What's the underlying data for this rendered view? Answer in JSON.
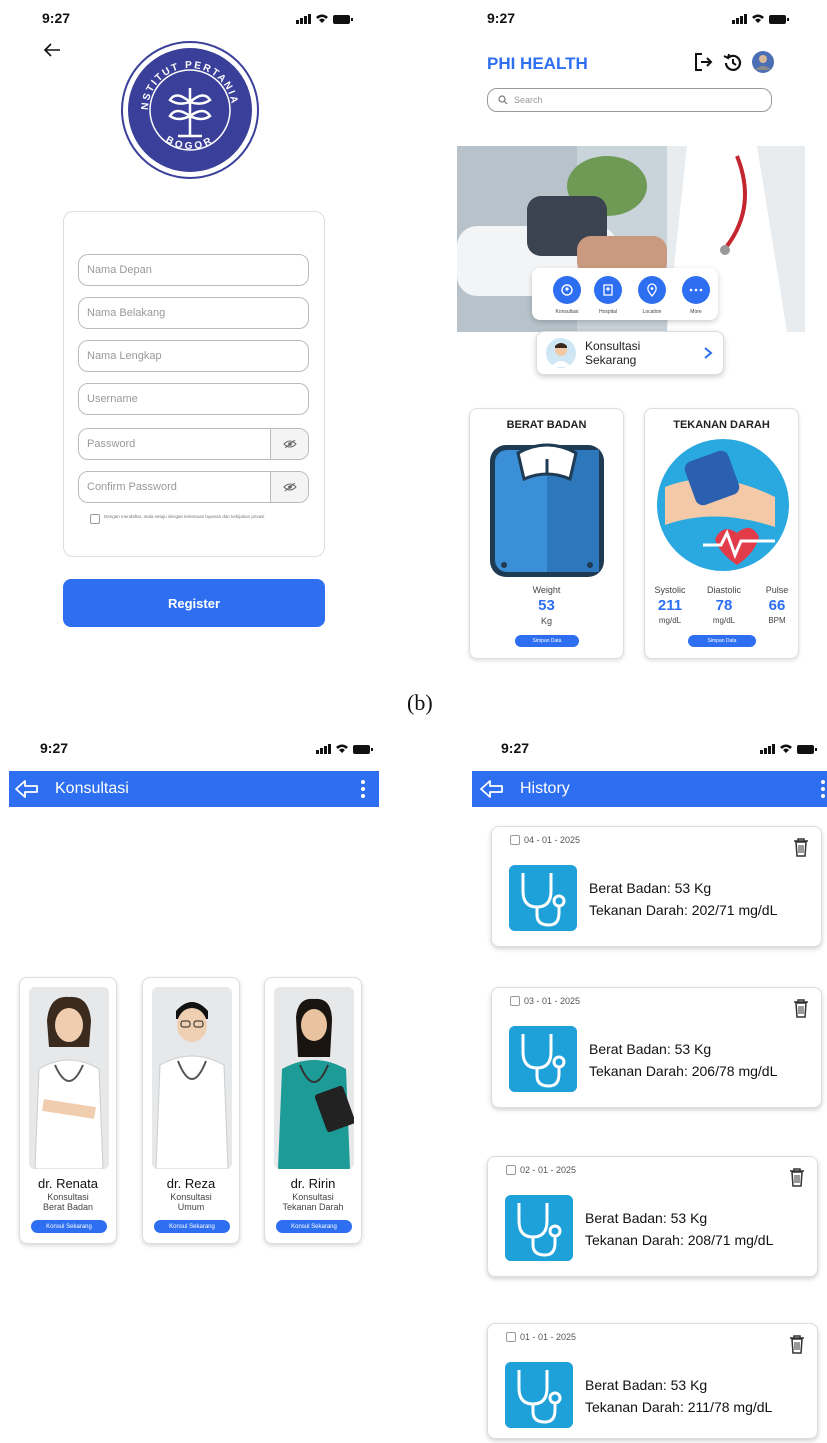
{
  "status_bar": {
    "time": "9:27"
  },
  "caption": "(b)",
  "register": {
    "logo_text": {
      "top": "INSTITUT PERTANIAN",
      "bottom": "BOGOR"
    },
    "fields": [
      {
        "placeholder": "Nama Depan"
      },
      {
        "placeholder": "Nama Belakang"
      },
      {
        "placeholder": "Nama Lengkap"
      },
      {
        "placeholder": "Username"
      },
      {
        "placeholder": "Password"
      },
      {
        "placeholder": "Confirm Password"
      }
    ],
    "terms": "Dengan mendaftar, anda setuju dengan ketentuan layanan dan kebijakan privasi",
    "register_label": "Register"
  },
  "home": {
    "brand": "PHI HEALTH",
    "search_placeholder": "Search",
    "categories": [
      "Konsultasi",
      "Hospital",
      "Location",
      "More"
    ],
    "consult_now": "Konsultasi Sekarang",
    "weight_card": {
      "title": "BERAT BADAN",
      "label": "Weight",
      "value": "53",
      "unit": "Kg",
      "save": "Simpan Data"
    },
    "bp_card": {
      "title": "TEKANAN DARAH",
      "systolic": {
        "label": "Systolic",
        "value": "211",
        "unit": "mg/dL"
      },
      "diastolic": {
        "label": "Diastolic",
        "value": "78",
        "unit": "mg/dL"
      },
      "pulse": {
        "label": "Pulse",
        "value": "66",
        "unit": "BPM"
      },
      "save": "Simpan Data"
    }
  },
  "consult": {
    "title": "Konsultasi",
    "doctors": [
      {
        "name": "dr. Renata",
        "role1": "Konsultasi",
        "role2": "Berat Badan",
        "button": "Konsul Sekarang"
      },
      {
        "name": "dr. Reza",
        "role1": "Konsultasi",
        "role2": "Umum",
        "button": "Konsul Sekarang"
      },
      {
        "name": "dr. Ririn",
        "role1": "Konsultasi",
        "role2": "Tekanan Darah",
        "button": "Konsul Sekarang"
      }
    ]
  },
  "history": {
    "title": "History",
    "items": [
      {
        "date": "04 - 01 - 2025",
        "weight": "Berat Badan: 53 Kg",
        "bp": "Tekanan Darah: 202/71 mg/dL"
      },
      {
        "date": "03 - 01 - 2025",
        "weight": "Berat Badan: 53 Kg",
        "bp": "Tekanan Darah: 206/78 mg/dL"
      },
      {
        "date": "02 - 01 - 2025",
        "weight": "Berat Badan: 53 Kg",
        "bp": "Tekanan Darah: 208/71 mg/dL"
      },
      {
        "date": "01 - 01 - 2025",
        "weight": "Berat Badan: 53 Kg",
        "bp": "Tekanan Darah: 211/78 mg/dL"
      }
    ]
  },
  "colors": {
    "primary": "#2e6ff2",
    "stethoscope_bg": "#1ea0d8",
    "logo_blue": "#3a3f9a"
  }
}
